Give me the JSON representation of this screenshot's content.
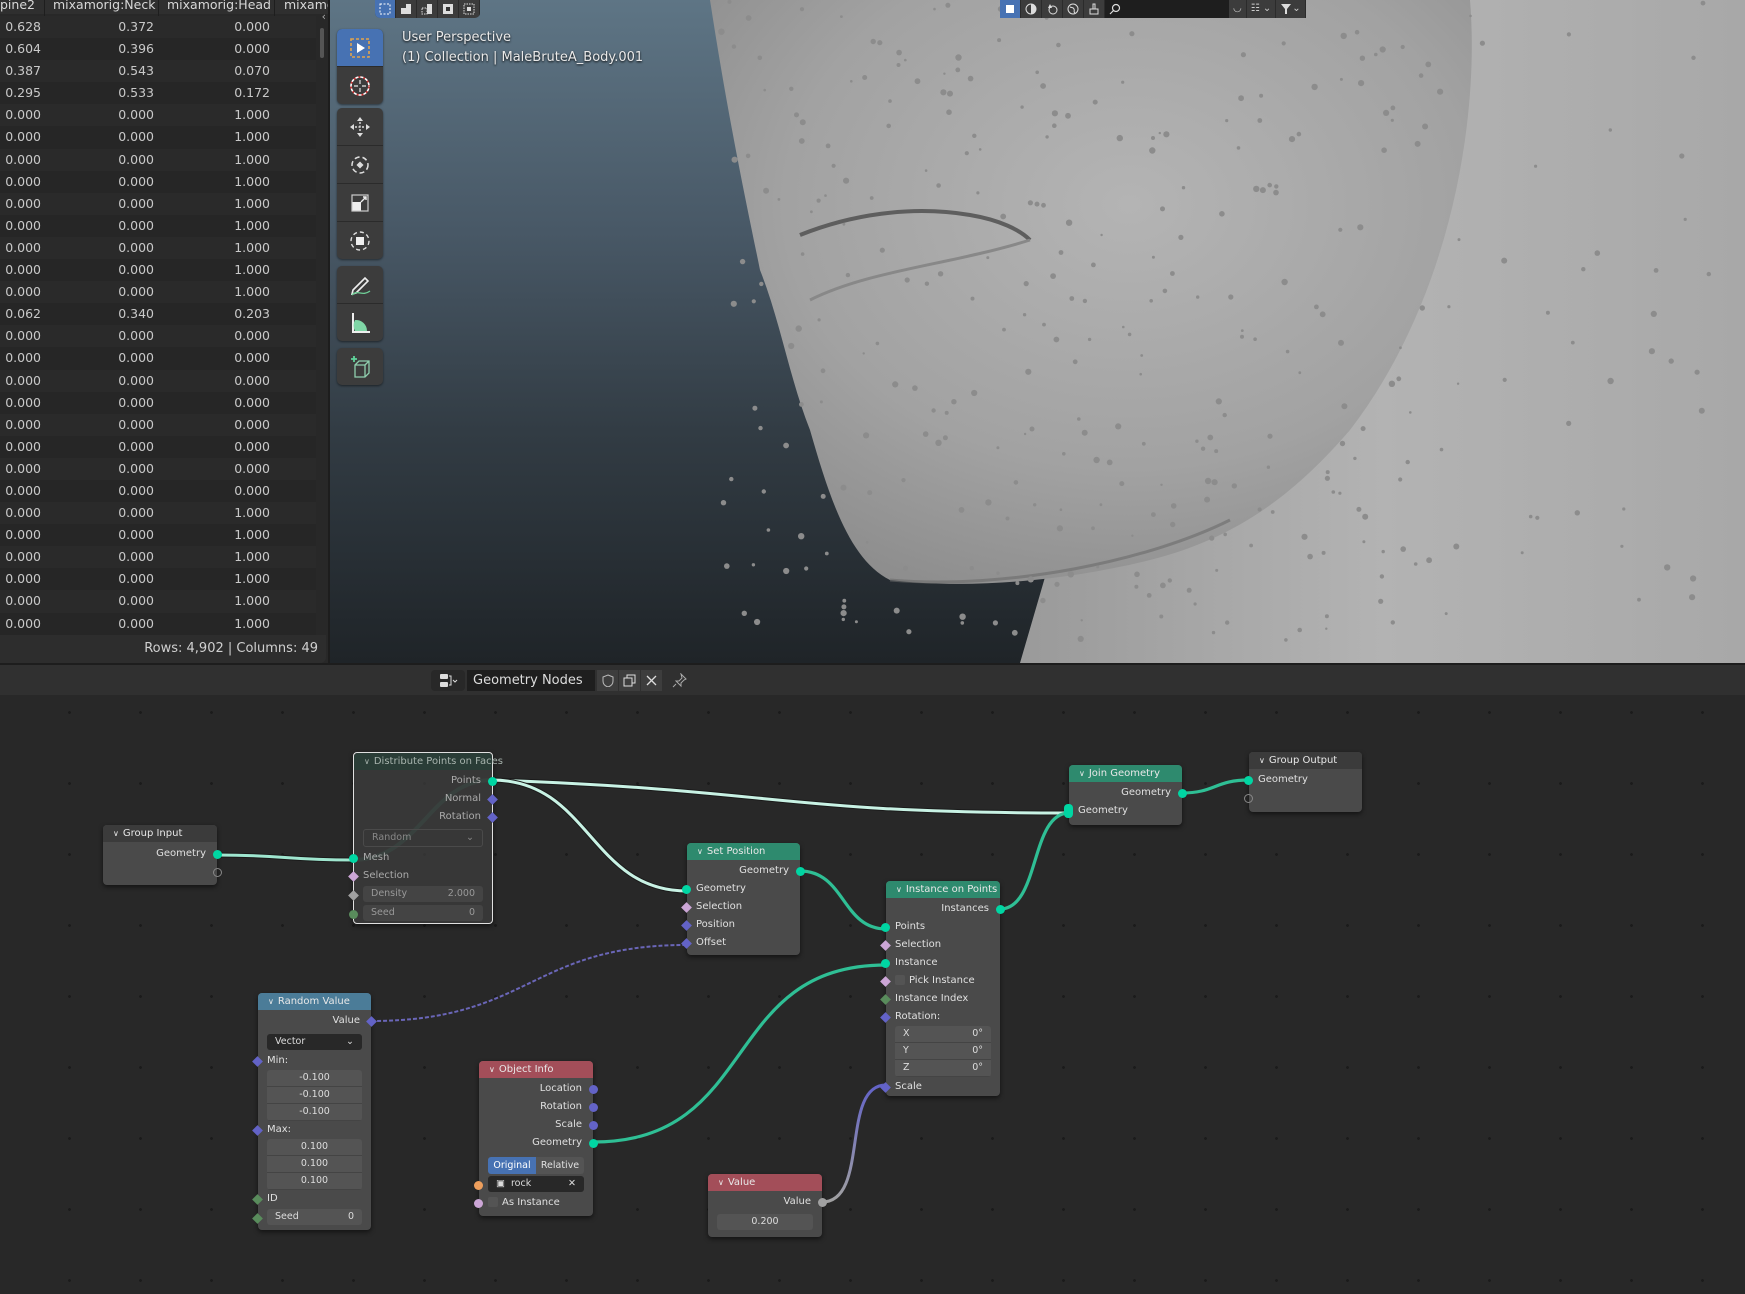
{
  "spreadsheet": {
    "columns": [
      "pine2",
      "mixamorig:Neck",
      "mixamorig:Head",
      "mixamo"
    ],
    "rows": [
      [
        "0.628",
        "0.372",
        "0.000"
      ],
      [
        "0.604",
        "0.396",
        "0.000"
      ],
      [
        "0.387",
        "0.543",
        "0.070"
      ],
      [
        "0.295",
        "0.533",
        "0.172"
      ],
      [
        "0.000",
        "0.000",
        "1.000"
      ],
      [
        "0.000",
        "0.000",
        "1.000"
      ],
      [
        "0.000",
        "0.000",
        "1.000"
      ],
      [
        "0.000",
        "0.000",
        "1.000"
      ],
      [
        "0.000",
        "0.000",
        "1.000"
      ],
      [
        "0.000",
        "0.000",
        "1.000"
      ],
      [
        "0.000",
        "0.000",
        "1.000"
      ],
      [
        "0.000",
        "0.000",
        "1.000"
      ],
      [
        "0.000",
        "0.000",
        "1.000"
      ],
      [
        "0.062",
        "0.340",
        "0.203"
      ],
      [
        "0.000",
        "0.000",
        "0.000"
      ],
      [
        "0.000",
        "0.000",
        "0.000"
      ],
      [
        "0.000",
        "0.000",
        "0.000"
      ],
      [
        "0.000",
        "0.000",
        "0.000"
      ],
      [
        "0.000",
        "0.000",
        "0.000"
      ],
      [
        "0.000",
        "0.000",
        "0.000"
      ],
      [
        "0.000",
        "0.000",
        "0.000"
      ],
      [
        "0.000",
        "0.000",
        "0.000"
      ],
      [
        "0.000",
        "0.000",
        "1.000"
      ],
      [
        "0.000",
        "0.000",
        "1.000"
      ],
      [
        "0.000",
        "0.000",
        "1.000"
      ],
      [
        "0.000",
        "0.000",
        "1.000"
      ],
      [
        "0.000",
        "0.000",
        "1.000"
      ],
      [
        "0.000",
        "0.000",
        "1.000"
      ]
    ],
    "footer": "Rows: 4,902   |   Columns: 49"
  },
  "viewport": {
    "view_name": "User Perspective",
    "object_info": "(1) Collection | MaleBruteA_Body.001",
    "background_top": "#5e7585",
    "background_bottom": "#1f2428",
    "tools": [
      "select-box",
      "cursor",
      "move",
      "rotate",
      "scale",
      "transform",
      "annotate",
      "measure",
      "add-cube"
    ],
    "active_tool": "select-box"
  },
  "node_editor": {
    "tree_name": "Geometry Nodes",
    "nodes": {
      "group_input": {
        "title": "Group Input",
        "outputs": [
          "Geometry"
        ]
      },
      "distribute": {
        "title": "Distribute Points on Faces",
        "outputs": [
          "Points",
          "Normal",
          "Rotation"
        ],
        "mode": "Random",
        "inputs": [
          "Mesh",
          "Selection"
        ],
        "density_label": "Density",
        "density": "2.000",
        "seed_label": "Seed",
        "seed": "0"
      },
      "set_position": {
        "title": "Set Position",
        "outputs": [
          "Geometry"
        ],
        "inputs": [
          "Geometry",
          "Selection",
          "Position",
          "Offset"
        ]
      },
      "instance_on_points": {
        "title": "Instance on Points",
        "outputs": [
          "Instances"
        ],
        "inputs": [
          "Points",
          "Selection",
          "Instance",
          "Pick Instance",
          "Instance Index",
          "Rotation:",
          "Scale"
        ],
        "rotation": [
          {
            "axis": "X",
            "value": "0°"
          },
          {
            "axis": "Y",
            "value": "0°"
          },
          {
            "axis": "Z",
            "value": "0°"
          }
        ]
      },
      "join_geometry": {
        "title": "Join Geometry",
        "outputs": [
          "Geometry"
        ],
        "inputs": [
          "Geometry"
        ]
      },
      "group_output": {
        "title": "Group Output",
        "inputs": [
          "Geometry"
        ]
      },
      "random_value": {
        "title": "Random Value",
        "outputs": [
          "Value"
        ],
        "data_type": "Vector",
        "min_label": "Min:",
        "min": [
          "-0.100",
          "-0.100",
          "-0.100"
        ],
        "max_label": "Max:",
        "max": [
          "0.100",
          "0.100",
          "0.100"
        ],
        "id_label": "ID",
        "seed_label": "Seed",
        "seed": "0"
      },
      "object_info": {
        "title": "Object Info",
        "outputs": [
          "Location",
          "Rotation",
          "Scale",
          "Geometry"
        ],
        "transform_space": [
          "Original",
          "Relative"
        ],
        "active_space": "Original",
        "object": "rock",
        "as_instance_label": "As Instance"
      },
      "value": {
        "title": "Value",
        "outputs": [
          "Value"
        ],
        "value": "0.200"
      }
    },
    "colors": {
      "geometry_socket": "#00d6a3",
      "vector_socket": "#6363c7",
      "geometry_header": "#2e8a6e",
      "input_header": "#a34e59",
      "utility_header": "#4b7c98"
    }
  }
}
